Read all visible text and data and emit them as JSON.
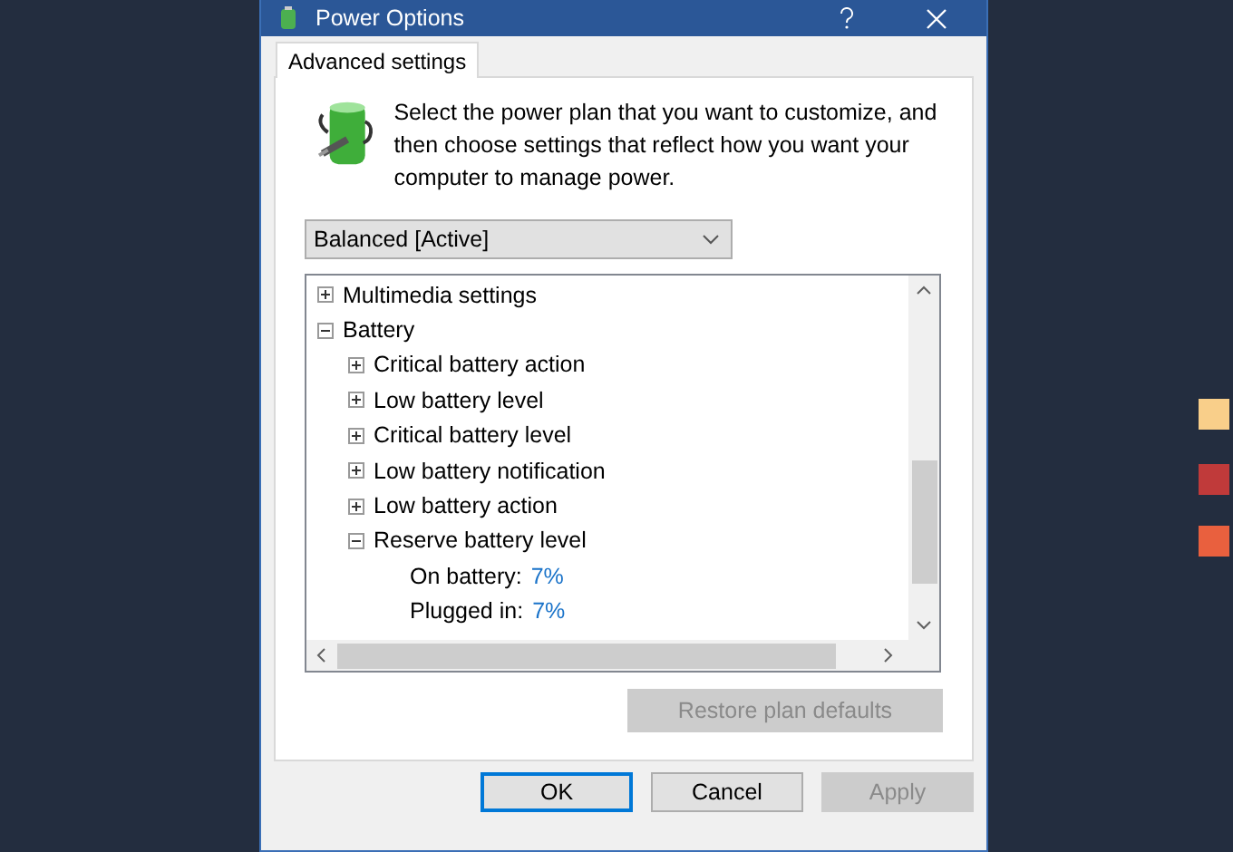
{
  "window": {
    "title": "Power Options"
  },
  "tabs": [
    {
      "label": "Advanced settings",
      "selected": true
    }
  ],
  "description": "Select the power plan that you want to customize, and then choose settings that reflect how you want your computer to manage power.",
  "plan_dropdown": {
    "value": "Balanced [Active]"
  },
  "tree": [
    {
      "label": "Multimedia settings",
      "expanded": false
    },
    {
      "label": "Battery",
      "expanded": true,
      "children": [
        {
          "label": "Critical battery action",
          "expanded": false
        },
        {
          "label": "Low battery level",
          "expanded": false
        },
        {
          "label": "Critical battery level",
          "expanded": false
        },
        {
          "label": "Low battery notification",
          "expanded": false
        },
        {
          "label": "Low battery action",
          "expanded": false
        },
        {
          "label": "Reserve battery level",
          "expanded": true,
          "children": [
            {
              "label": "On battery:",
              "value": "7%"
            },
            {
              "label": "Plugged in:",
              "value": "7%"
            }
          ]
        }
      ]
    }
  ],
  "restore_button": {
    "label": "Restore plan defaults",
    "disabled": true
  },
  "buttons": [
    {
      "label": "OK",
      "default": true,
      "disabled": false
    },
    {
      "label": "Cancel",
      "default": false,
      "disabled": false
    },
    {
      "label": "Apply",
      "default": false,
      "disabled": true
    }
  ],
  "swatches": [
    {
      "color": "#f9cf8a"
    },
    {
      "color": "#c03a3a"
    },
    {
      "color": "#e9603e"
    }
  ]
}
